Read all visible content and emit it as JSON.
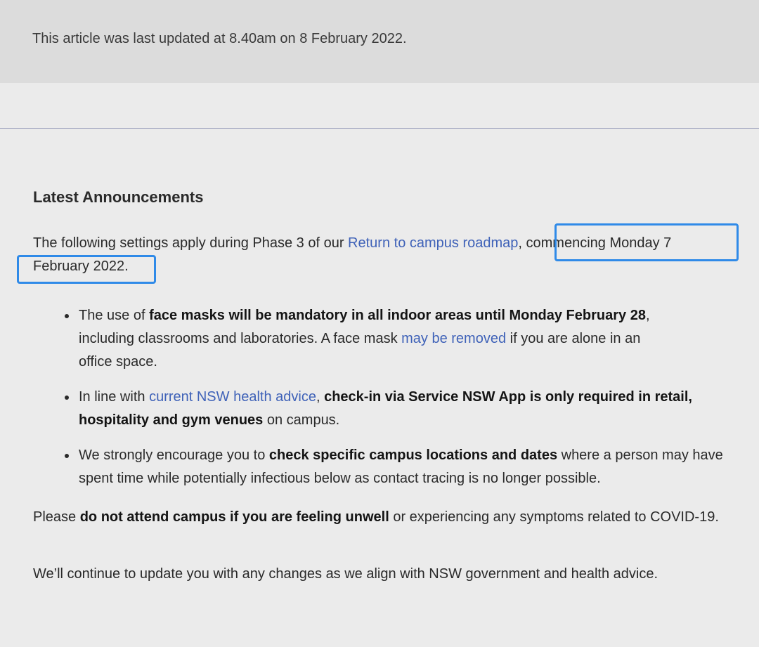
{
  "banner": {
    "update_text": "This article was last updated at 8.40am on 8 February 2022."
  },
  "announcements": {
    "heading": "Latest Announcements",
    "intro": {
      "before_link": "The following settings apply during Phase 3 of our ",
      "link": "Return to campus roadmap",
      "after_link": ", commencing Monday 7 February 2022."
    },
    "bullets": [
      {
        "t1": "The use of ",
        "b1": "face masks will be mandatory in all indoor areas until Monday February 28",
        "t2": ", including classrooms and laboratories. A face mask ",
        "link": "may be removed",
        "t3": " if you are alone in an office space."
      },
      {
        "t1": "In line with ",
        "link": "current NSW health advice",
        "t2": ", ",
        "b1": "check-in via Service NSW App is only required in retail, hospitality and gym venues",
        "t3": " on campus."
      },
      {
        "t1": "We strongly encourage you to ",
        "b1": "check specific campus locations and dates",
        "t2": " where a person may have spent time while potentially infectious below as contact tracing is no longer possible."
      }
    ],
    "warning": {
      "t1": "Please ",
      "b1": "do not attend campus if you are feeling unwell",
      "t2": " or experiencing any symptoms related to COVID-19."
    },
    "continue_note": "We’ll continue to update you with any changes as we align with NSW government and health advice."
  },
  "colors": {
    "link": "#3f62b8",
    "highlight": "#2f8ae8",
    "banner_bg": "#dcdcdc",
    "page_bg": "#ebebeb",
    "divider": "#8e94b4"
  }
}
